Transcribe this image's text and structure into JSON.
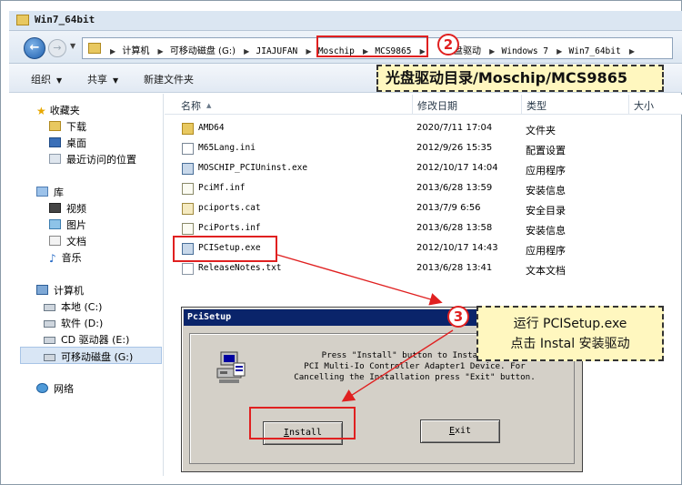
{
  "window": {
    "title": "Win7_64bit"
  },
  "address": {
    "crumbs": [
      "计算机",
      "可移动磁盘 (G:)",
      "JIAJUFAN",
      "Moschip",
      "MCS9865",
      "光盘驱动",
      "Windows 7",
      "Win7_64bit"
    ]
  },
  "toolbar": {
    "organize": "组织",
    "share": "共享",
    "new_folder": "新建文件夹"
  },
  "callout2": {
    "badge": "2",
    "text": "光盘驱动目录/Moschip/MCS9865"
  },
  "sidebar": {
    "favorites": "收藏夹",
    "fav_items": [
      "下载",
      "桌面",
      "最近访问的位置"
    ],
    "libraries": "库",
    "lib_items": [
      "视频",
      "图片",
      "文档",
      "音乐"
    ],
    "computer": "计算机",
    "drives": [
      "本地 (C:)",
      "软件 (D:)",
      "CD 驱动器 (E:)",
      "可移动磁盘 (G:)"
    ],
    "network": "网络"
  },
  "columns": {
    "name": "名称",
    "modified": "修改日期",
    "type": "类型",
    "size": "大小"
  },
  "files": [
    {
      "name": "AMD64",
      "date": "2020/7/11 17:04",
      "type": "文件夹",
      "icon": "folder-icon"
    },
    {
      "name": "M65Lang.ini",
      "date": "2012/9/26 15:35",
      "type": "配置设置",
      "icon": "settings-file-icon"
    },
    {
      "name": "MOSCHIP_PCIUninst.exe",
      "date": "2012/10/17 14:04",
      "type": "应用程序",
      "icon": "application-icon"
    },
    {
      "name": "PciMf.inf",
      "date": "2013/6/28 13:59",
      "type": "安装信息",
      "icon": "setup-info-icon"
    },
    {
      "name": "pciports.cat",
      "date": "2013/7/9 6:56",
      "type": "安全目录",
      "icon": "security-catalog-icon"
    },
    {
      "name": "PciPorts.inf",
      "date": "2013/6/28 13:58",
      "type": "安装信息",
      "icon": "setup-info-icon"
    },
    {
      "name": "PCISetup.exe",
      "date": "2012/10/17 14:43",
      "type": "应用程序",
      "icon": "setup-application-icon"
    },
    {
      "name": "ReleaseNotes.txt",
      "date": "2013/6/28 13:41",
      "type": "文本文档",
      "icon": "text-file-icon"
    }
  ],
  "dialog": {
    "title": "PciSetup",
    "message": [
      "Press \"Install\" button to Install the",
      "PCI Multi-Io Controller Adapter1 Device. For",
      "Cancelling the Installation press \"Exit\" button."
    ],
    "install_acc": "I",
    "install_rest": "nstall",
    "exit_acc": "E",
    "exit_rest": "xit"
  },
  "callout3": {
    "badge": "3",
    "line1": "运行 PCISetup.exe",
    "line2": "点击 Instal 安装驱动"
  },
  "colors": {
    "accent_red": "#e02020",
    "callout_bg": "#fff7bf",
    "dialog_title_bg": "#0a246a"
  }
}
